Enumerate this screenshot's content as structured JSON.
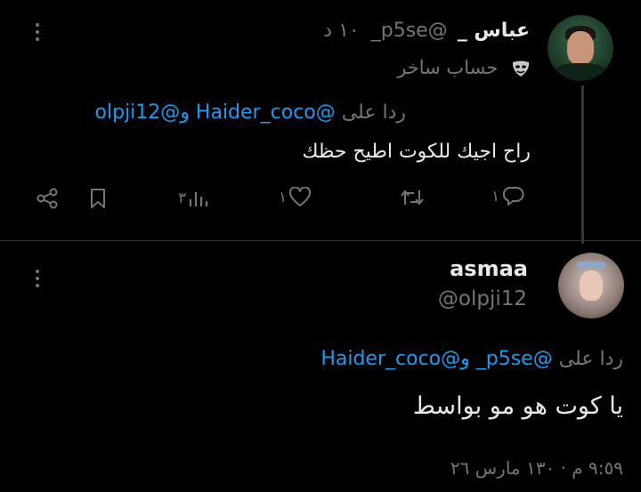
{
  "tweet1": {
    "author_name": "عباس _",
    "handle": "@p5se_",
    "time": "١٠ د",
    "badge_text": "حساب ساخر",
    "reply_prefix": "ردا على",
    "reply_mention1": "@Haider_coco",
    "reply_and": "و",
    "reply_mention2": "@olpji12",
    "text": "راح اجيك للكوت اطيح حظك",
    "actions": {
      "reply_count": "١",
      "retweet_count": "",
      "like_count": "١",
      "views_count": "٣"
    }
  },
  "tweet2": {
    "author_name": "asmaa",
    "handle": "@olpji12",
    "reply_prefix": "ردا على",
    "reply_mention1": "@p5se_",
    "reply_and": "و",
    "reply_mention2": "@Haider_coco",
    "text": "يا كوت هو مو بواسط",
    "timestamp": "٩:٥٩ م · ١٣٠ مارس ٢٦"
  },
  "icons": {
    "badge": "mask-icon",
    "reply": "reply-icon",
    "retweet": "retweet-icon",
    "like": "heart-icon",
    "views": "views-icon",
    "bookmark": "bookmark-icon",
    "share": "share-icon",
    "more": "more-icon"
  },
  "colors": {
    "background": "#000000",
    "text": "#e7e9ea",
    "muted": "#71767b",
    "link": "#1d9bf0"
  }
}
